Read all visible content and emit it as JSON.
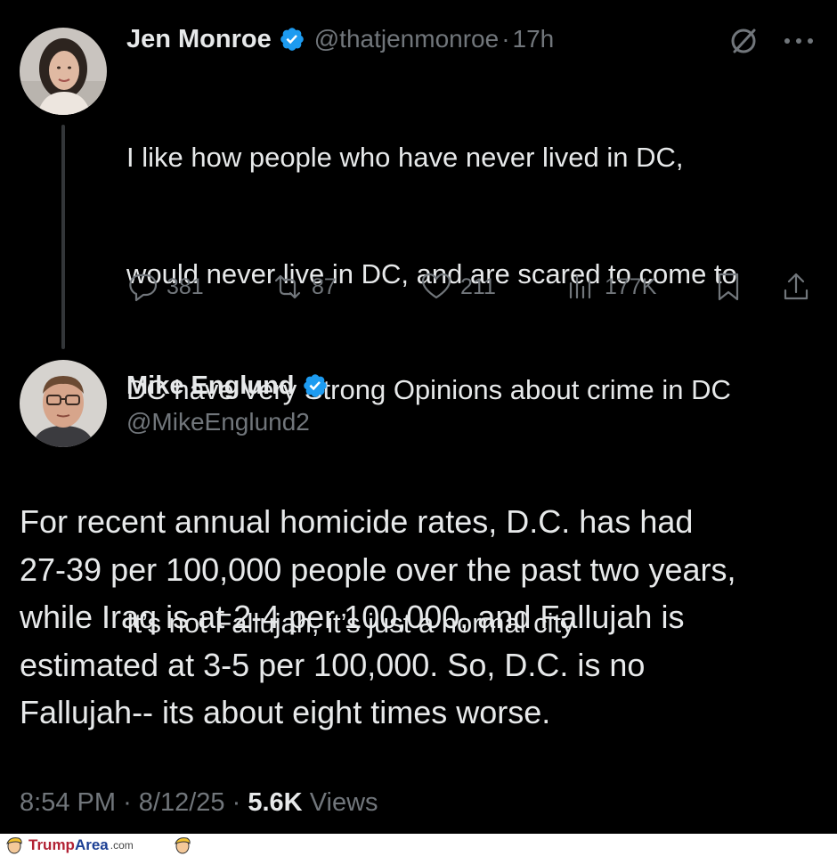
{
  "tweet1": {
    "name": "Jen Monroe",
    "handle": "@thatjenmonroe",
    "separator": "·",
    "time": "17h",
    "lines": [
      "I like how people who have never lived in DC,",
      "would never live in DC, and are scared to come to",
      "DC have Very Strong Opinions about crime in DC"
    ],
    "line2": "It’s not Fallujah, it’s just a normal city",
    "replies": "381",
    "reposts": "87",
    "likes": "211",
    "views": "177K"
  },
  "tweet2": {
    "name": "Mike Englund",
    "handle": "@MikeEnglund2",
    "lines": [
      "For recent annual homicide rates, D.C. has had",
      "27-39 per 100,000 people over the past two years,",
      "while Iraq is at 2-4 per 100,000, and Fallujah is",
      "estimated at 3-5 per 100,000. So, D.C. is no",
      "Fallujah-- its about eight times worse."
    ],
    "time": "8:54 PM",
    "separator": "·",
    "date": "8/12/25",
    "views_count": "5.6K",
    "views_label": "Views"
  },
  "watermark": {
    "brand_a": "Trump",
    "brand_b": "Area",
    "brand_c": ".com"
  },
  "colors": {
    "background": "#000000",
    "text": "#e7e9ea",
    "muted": "#71767b",
    "verified": "#1d9bf0"
  }
}
